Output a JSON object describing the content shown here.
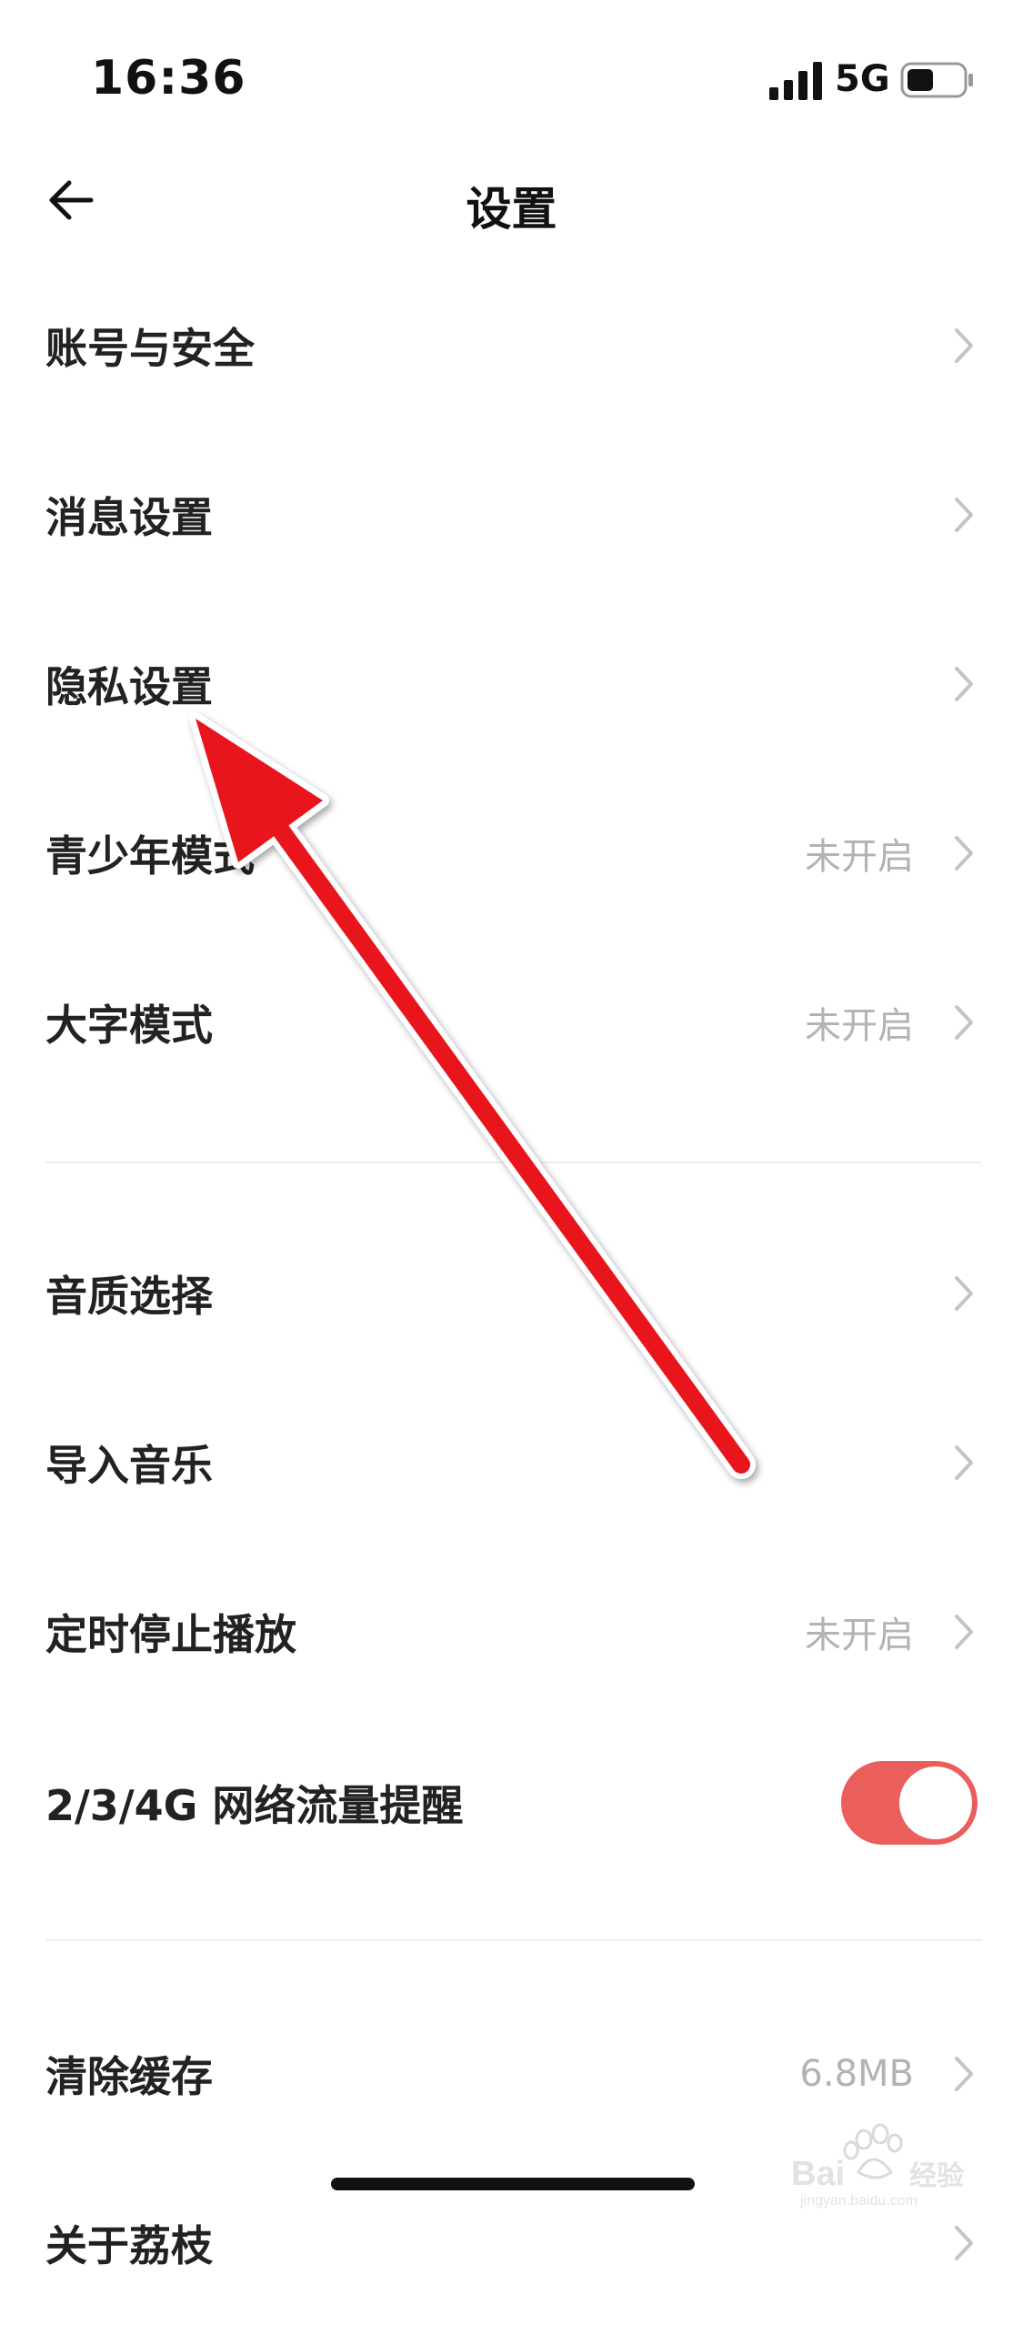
{
  "status_bar": {
    "time": "16:36",
    "network": "5G",
    "signal_icon": "signal-bars-icon",
    "battery_icon": "battery-icon"
  },
  "nav": {
    "title": "设置",
    "back_icon": "back-arrow-icon"
  },
  "sections": [
    {
      "items": [
        {
          "label": "账号与安全",
          "value": ""
        },
        {
          "label": "消息设置",
          "value": ""
        },
        {
          "label": "隐私设置",
          "value": ""
        },
        {
          "label": "青少年模式",
          "value": "未开启"
        },
        {
          "label": "大字模式",
          "value": "未开启"
        }
      ]
    },
    {
      "items": [
        {
          "label": "音质选择",
          "value": ""
        },
        {
          "label": "导入音乐",
          "value": ""
        },
        {
          "label": "定时停止播放",
          "value": "未开启"
        },
        {
          "label": "2/3/4G 网络流量提醒",
          "toggle": true
        }
      ]
    },
    {
      "items": [
        {
          "label": "清除缓存",
          "value": "6.8MB"
        },
        {
          "label": "关于荔枝",
          "value": ""
        }
      ]
    }
  ],
  "colors": {
    "toggle_on": "#ea5e5c",
    "annotation_arrow": "#e8161b",
    "secondary_text": "#b3b3b3"
  },
  "watermark": {
    "text": "Bai 经验",
    "subtext": "jingyan.baidu.com"
  }
}
